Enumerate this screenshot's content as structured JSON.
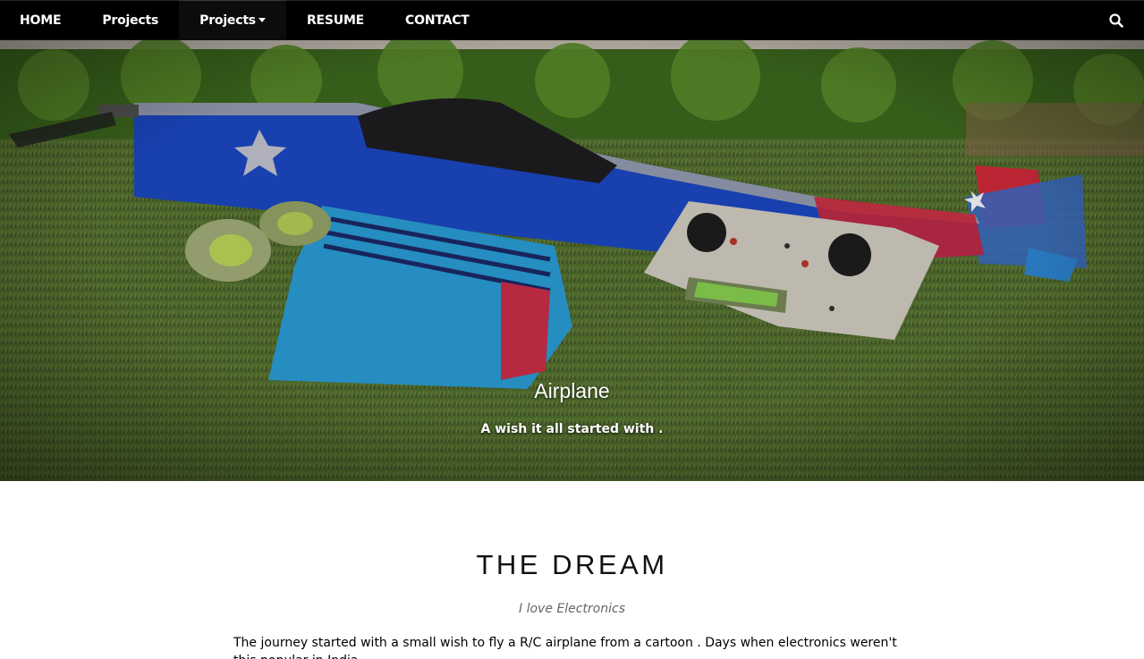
{
  "navbar": {
    "items": [
      {
        "label": "HOME"
      },
      {
        "label": "Projects"
      },
      {
        "label": "Projects"
      },
      {
        "label": "RESUME"
      },
      {
        "label": "CONTACT"
      }
    ],
    "search_icon": "search-icon",
    "background": "#000000"
  },
  "hero": {
    "title": "Airplane",
    "subtitle": "A wish it all started with ."
  },
  "section": {
    "title": "THE DREAM",
    "subtitle": "I love Electronics",
    "body": "The journey started with a small wish to fly a R/C airplane from a cartoon . Days when electronics weren't this popular in India ."
  }
}
